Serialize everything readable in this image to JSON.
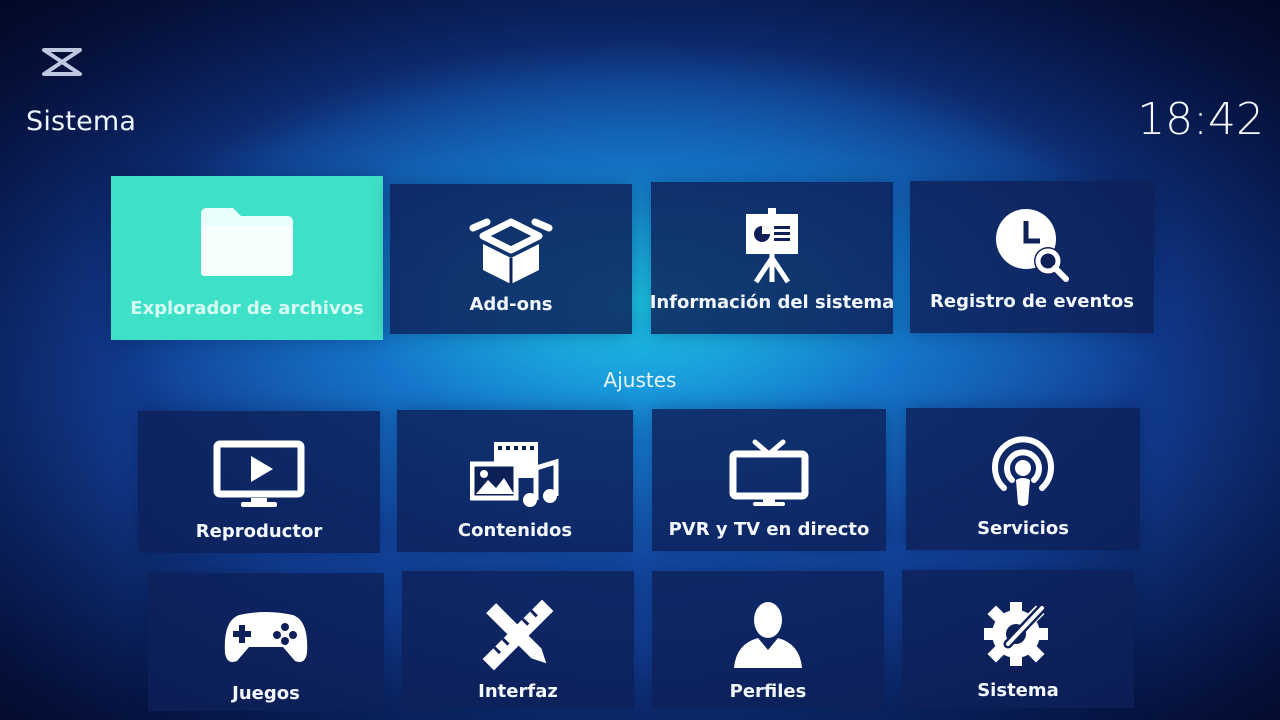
{
  "header": {
    "title": "Sistema",
    "time": "18:42"
  },
  "top_row": [
    {
      "label": "Explorador de archivos",
      "icon": "folder-icon",
      "focused": true
    },
    {
      "label": "Add-ons",
      "icon": "box-icon"
    },
    {
      "label": "Información del sistema",
      "icon": "presentation-board-icon"
    },
    {
      "label": "Registro de eventos",
      "icon": "clock-search-icon"
    }
  ],
  "settings_header": "Ajustes",
  "settings_row1": [
    {
      "label": "Reproductor",
      "icon": "tv-play-icon"
    },
    {
      "label": "Contenidos",
      "icon": "media-library-icon"
    },
    {
      "label": "PVR y TV en directo",
      "icon": "retro-tv-icon"
    },
    {
      "label": "Servicios",
      "icon": "podcast-icon"
    }
  ],
  "settings_row2": [
    {
      "label": "Juegos",
      "icon": "gamepad-icon"
    },
    {
      "label": "Interfaz",
      "icon": "pencil-ruler-icon"
    },
    {
      "label": "Perfiles",
      "icon": "user-profile-icon"
    },
    {
      "label": "Sistema",
      "icon": "gear-wrench-icon"
    }
  ],
  "colors": {
    "focus": "#3fe0c8",
    "tile": "#0e2058",
    "glow": "#1edcf0"
  }
}
